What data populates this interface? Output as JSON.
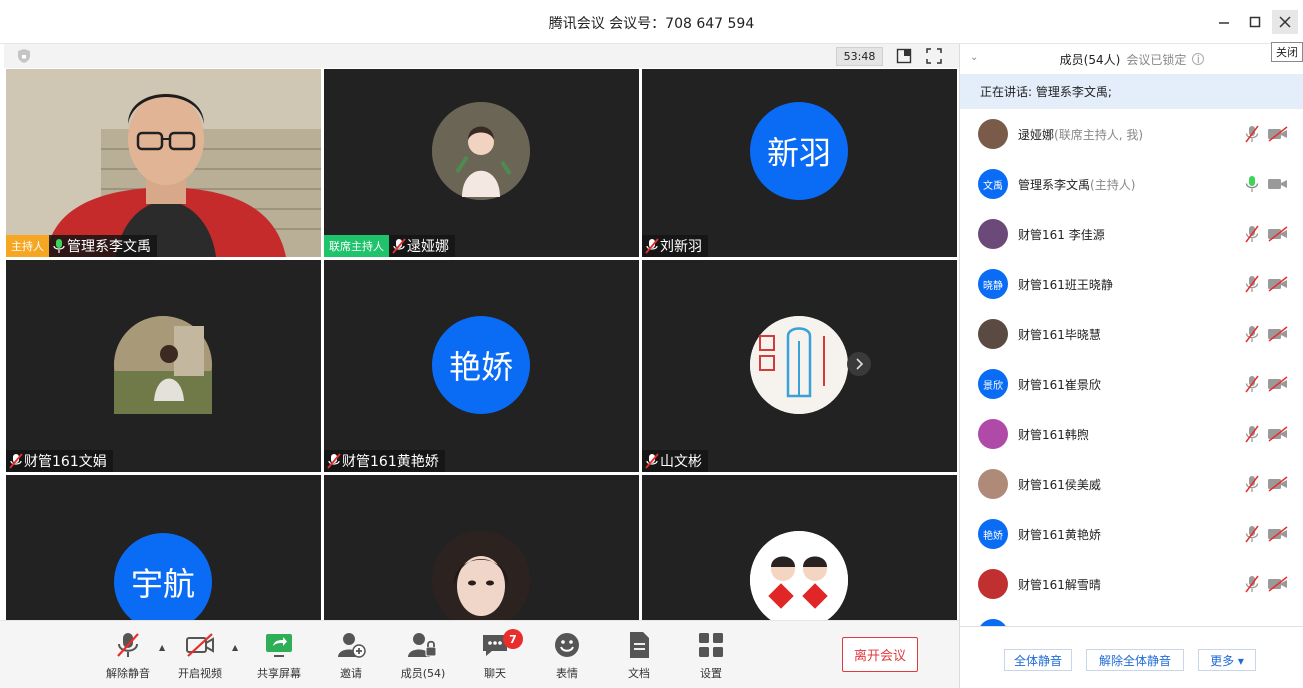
{
  "window": {
    "title": "腾讯会议 会议号：708 647 594",
    "tooltip": "关闭"
  },
  "video_toolbar": {
    "timer": "53:48"
  },
  "tiles": [
    {
      "name": "管理系李文禹",
      "role": "主持人",
      "role_type": "host",
      "mic": "on",
      "kind": "camera"
    },
    {
      "name": "逯娅娜",
      "role": "联席主持人",
      "role_type": "cohost",
      "mic": "muted",
      "kind": "photo"
    },
    {
      "name": "刘新羽",
      "mic": "muted",
      "kind": "initials",
      "initials": "新羽"
    },
    {
      "name": "财管161文娟",
      "mic": "muted",
      "kind": "photo"
    },
    {
      "name": "财管161黄艳娇",
      "mic": "muted",
      "kind": "initials",
      "initials": "艳娇"
    },
    {
      "name": "山文彬",
      "mic": "muted",
      "kind": "photo"
    },
    {
      "kind": "initials",
      "initials": "宇航"
    },
    {
      "kind": "photo"
    },
    {
      "kind": "photo"
    }
  ],
  "toolbar": {
    "unmute": "解除静音",
    "start_video": "开启视频",
    "share_screen": "共享屏幕",
    "invite": "邀请",
    "members": "成员(54)",
    "chat": "聊天",
    "chat_badge": "7",
    "reactions": "表情",
    "docs": "文档",
    "settings": "设置",
    "leave": "离开会议"
  },
  "panel": {
    "header": "成员(54人)",
    "locked": "会议已锁定",
    "speaking": "正在讲话: 管理系李文禹;",
    "members": [
      {
        "name": "逯娅娜",
        "sub": "(联席主持人, 我)",
        "avatar": "photo",
        "mic": "muted",
        "cam": "off"
      },
      {
        "name": "管理系李文禹",
        "sub": "(主持人)",
        "avatar": "文禹",
        "mic": "on",
        "cam": "on"
      },
      {
        "name": "财管161 李佳源",
        "sub": "",
        "avatar": "photo",
        "mic": "muted",
        "cam": "off"
      },
      {
        "name": "财管161班王晓静",
        "sub": "",
        "avatar": "晓静",
        "mic": "muted",
        "cam": "off"
      },
      {
        "name": "财管161毕晓慧",
        "sub": "",
        "avatar": "photo",
        "mic": "muted",
        "cam": "off"
      },
      {
        "name": "财管161崔景欣",
        "sub": "",
        "avatar": "景欣",
        "mic": "muted",
        "cam": "off"
      },
      {
        "name": "财管161韩煦",
        "sub": "",
        "avatar": "photo",
        "mic": "muted",
        "cam": "off"
      },
      {
        "name": "财管161侯美威",
        "sub": "",
        "avatar": "photo",
        "mic": "muted",
        "cam": "off"
      },
      {
        "name": "财管161黄艳娇",
        "sub": "",
        "avatar": "艳娇",
        "mic": "muted",
        "cam": "off"
      },
      {
        "name": "财管161解雪晴",
        "sub": "",
        "avatar": "photo",
        "mic": "muted",
        "cam": "off"
      }
    ],
    "mute_all": "全体静音",
    "unmute_all": "解除全体静音",
    "more": "更多 ▾"
  },
  "colors": {
    "accent": "#0a6cf5",
    "danger": "#e2393c",
    "host": "#f5a623",
    "cohost": "#1fc36b",
    "tile_bg": "#222222"
  }
}
